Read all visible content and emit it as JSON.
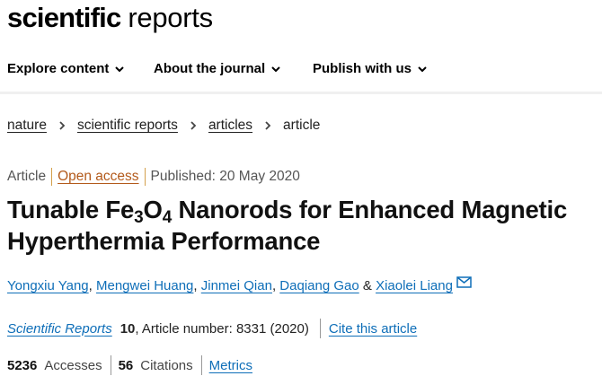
{
  "logo": {
    "bold": "scientific",
    "light": "reports"
  },
  "nav": {
    "items": [
      {
        "label": "Explore content"
      },
      {
        "label": "About the journal"
      },
      {
        "label": "Publish with us"
      }
    ]
  },
  "breadcrumb": {
    "items": [
      "nature",
      "scientific reports",
      "articles"
    ],
    "current": "article"
  },
  "meta": {
    "type": "Article",
    "access": "Open access",
    "published": "Published: 20 May 2020"
  },
  "title": {
    "part1": "Tunable Fe",
    "sub1": "3",
    "part2": "O",
    "sub2": "4",
    "part3": " Nanorods for Enhanced Magnetic Hyperthermia Performance"
  },
  "authors": {
    "list": [
      "Yongxiu Yang",
      "Mengwei Huang",
      "Jinmei Qian",
      "Daqiang Gao",
      "Xiaolei Liang"
    ],
    "comma": ",",
    "amp": "&"
  },
  "citation": {
    "journal": "Scientific Reports",
    "volume": "10",
    "article_number": ", Article number: 8331 (2020)",
    "cite_link": "Cite this article"
  },
  "metrics": {
    "accesses_count": "5236",
    "accesses_label": "Accesses",
    "citations_count": "56",
    "citations_label": "Citations",
    "metrics_link": "Metrics"
  },
  "colors": {
    "link": "#0e6eb8",
    "open_access": "#b35a1b",
    "divider_accent": "#d4a04c"
  }
}
